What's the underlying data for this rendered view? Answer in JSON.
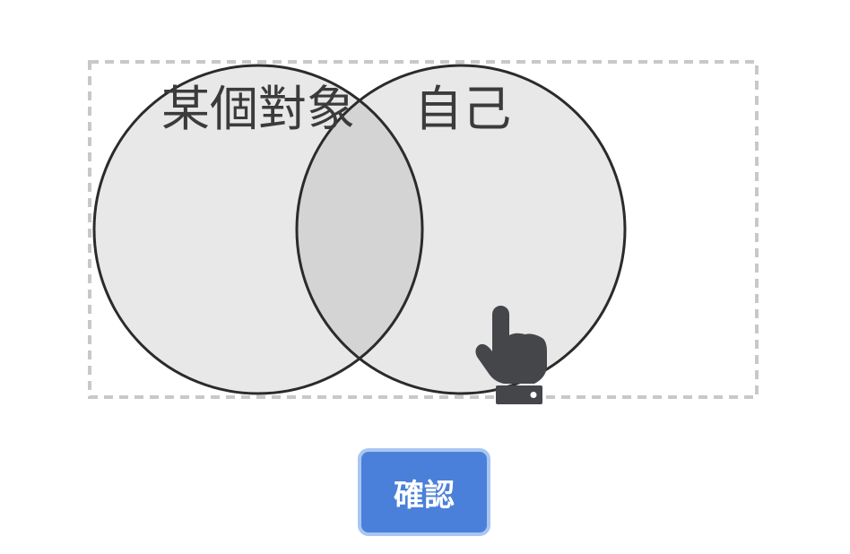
{
  "venn": {
    "left_set_label": "某個對象",
    "right_set_label": "自己"
  },
  "colors": {
    "circle_fill": "#e8e8e8",
    "overlap_fill": "#d4d4d4",
    "circle_stroke": "#2b2b2b",
    "drop_zone_border": "#c8c8c8",
    "button_fill": "#4a80d9",
    "button_ring": "#a9c6f3"
  },
  "cursor_icon": "hand-pointer-icon",
  "confirm_button": {
    "label": "確認"
  }
}
